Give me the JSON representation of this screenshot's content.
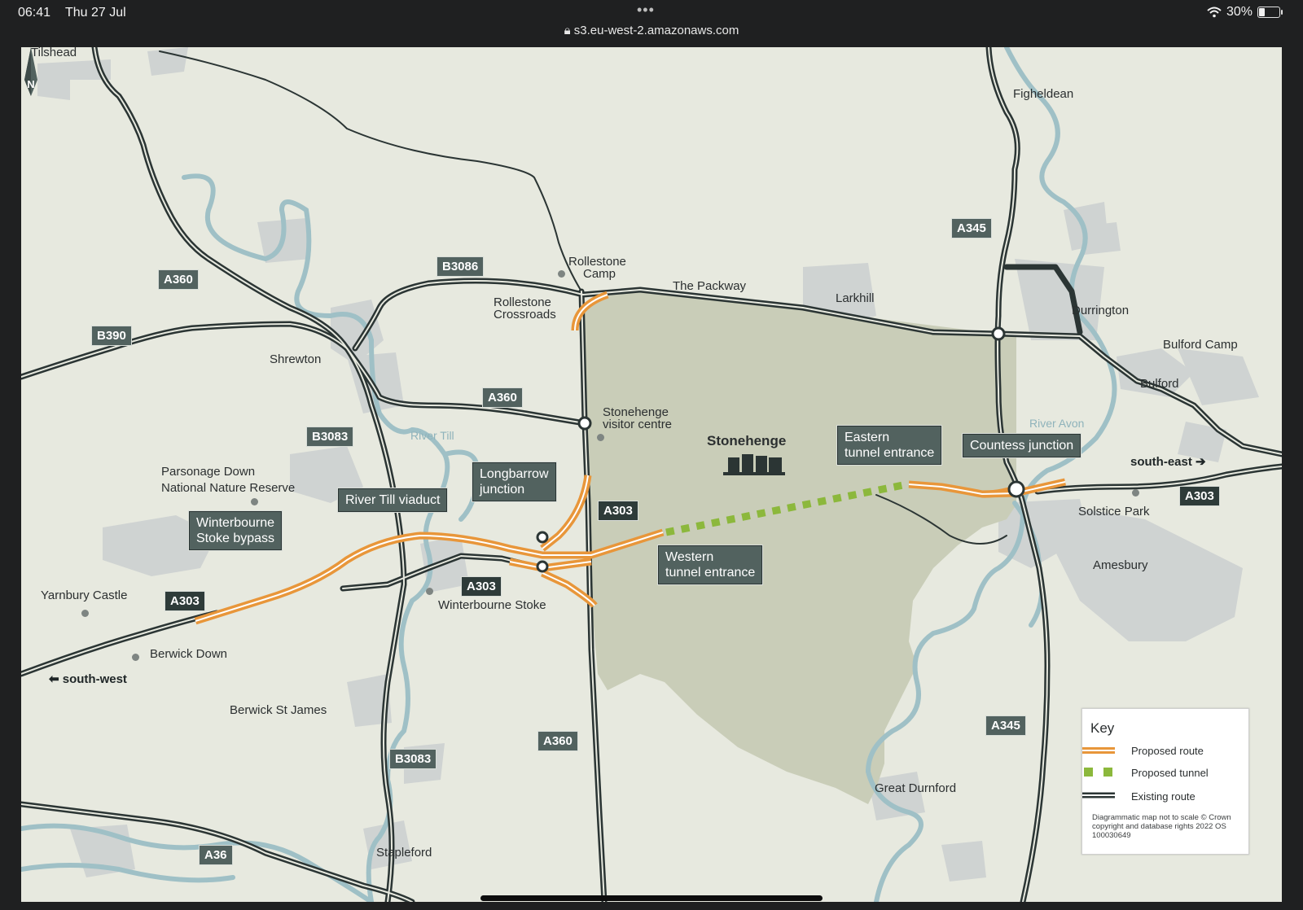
{
  "status_bar": {
    "time": "06:41",
    "date": "Thu 27 Jul",
    "url": "s3.eu-west-2.amazonaws.com",
    "battery_percent": "30%",
    "battery_level": 0.3
  },
  "places": {
    "tilshead": "Tilshead",
    "figheldean": "Figheldean",
    "rollestone_camp_1": "Rollestone",
    "rollestone_camp_2": "Camp",
    "the_packway": "The Packway",
    "larkhill": "Larkhill",
    "durrington": "Durrington",
    "bulford_camp": "Bulford Camp",
    "bulford": "Bulford",
    "shrewton": "Shrewton",
    "rollestone_crossroads_1": "Rollestone",
    "rollestone_crossroads_2": "Crossroads",
    "visitor_centre_1": "Stonehenge",
    "visitor_centre_2": "visitor centre",
    "stonehenge": "Stonehenge",
    "parsonage_1": "Parsonage Down",
    "parsonage_2": "National Nature Reserve",
    "solstice_park": "Solstice Park",
    "amesbury": "Amesbury",
    "yarnbury_castle": "Yarnbury Castle",
    "winterbourne_stoke": "Winterbourne Stoke",
    "berwick_down": "Berwick Down",
    "berwick_st_james": "Berwick St James",
    "great_durnford": "Great Durnford",
    "stapleford": "Stapleford",
    "river_till": "River Till",
    "river_avon": "River Avon",
    "south_east": "south-east",
    "south_west": "south-west"
  },
  "roads": {
    "a360_1": "A360",
    "a360_2": "A360",
    "a360_3": "A360",
    "b3086": "B3086",
    "b390": "B390",
    "b3083_1": "B3083",
    "b3083_2": "B3083",
    "a345_1": "A345",
    "a345_2": "A345",
    "a303_1": "A303",
    "a303_2": "A303",
    "a303_3": "A303",
    "a303_4": "A303",
    "a36": "A36"
  },
  "callouts": {
    "longbarrow_1": "Longbarrow",
    "longbarrow_2": "junction",
    "river_till_viaduct": "River Till viaduct",
    "winterbourne_bypass_1": "Winterbourne",
    "winterbourne_bypass_2": "Stoke bypass",
    "eastern_1": "Eastern",
    "eastern_2": "tunnel entrance",
    "countess": "Countess junction",
    "western_1": "Western",
    "western_2": "tunnel entrance"
  },
  "key": {
    "title": "Key",
    "proposed_route": "Proposed route",
    "proposed_tunnel": "Proposed tunnel",
    "existing_route": "Existing route",
    "note": "Diagrammatic map not to scale © Crown copyright and database rights 2022 OS 100030649"
  },
  "colors": {
    "proposed_route": "#e8963a",
    "proposed_tunnel": "#8cb83c",
    "existing_route": "#2b3534",
    "river": "#9fc0c6",
    "settlement": "#cfd3d2",
    "whs": "#c9cdb8",
    "land": "#e7e9df"
  },
  "north_label": "N"
}
